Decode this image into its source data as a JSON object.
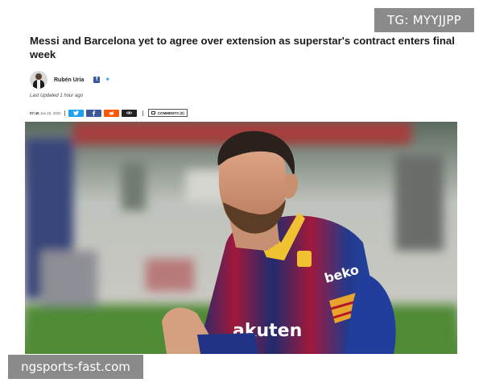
{
  "watermarks": {
    "top": "TG: MYYJJPP",
    "bottom": "ngsports-fast.com"
  },
  "article": {
    "headline": "Messi and Barcelona yet to agree over extension as superstar's contract enters final week",
    "author": "Rubén Uría",
    "last_updated": "Last Updated  1 hour ago",
    "time": "07:40",
    "date": "Jun 23, 2021",
    "comments_label": "COMMENTS (0)"
  },
  "share_icons": [
    "twitter-icon",
    "facebook-icon",
    "reddit-icon",
    "link-icon"
  ],
  "photo": {
    "sponsor_text": "akuten",
    "brand_text": "beko"
  },
  "colors": {
    "twitter": "#1da1f2",
    "facebook": "#3b5998",
    "reddit": "#ff5700",
    "link": "#222222",
    "watermark_bg": "#8a8a8a"
  }
}
